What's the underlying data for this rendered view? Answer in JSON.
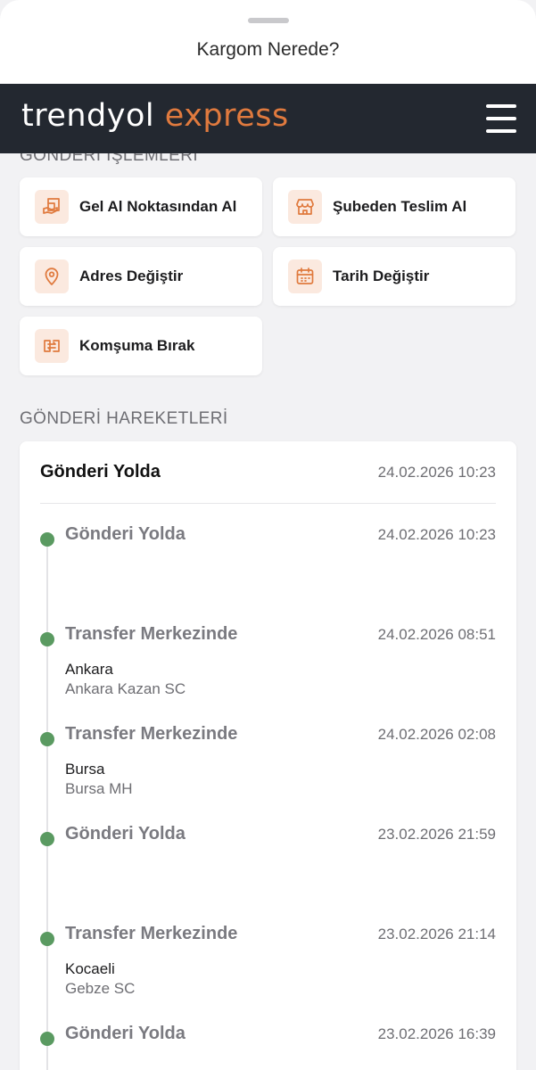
{
  "sheet": {
    "title": "Kargom Nerede?"
  },
  "header": {
    "logo_part1": "trendyol",
    "logo_part2": "express",
    "accent_color": "#e07a3e",
    "bar_color": "#232830"
  },
  "operations": {
    "title": "GÖNDERİ İŞLEMLERİ",
    "items": [
      {
        "label": "Gel Al Noktasından Al",
        "icon": "pickup-point-icon"
      },
      {
        "label": "Şubeden Teslim Al",
        "icon": "store-icon"
      },
      {
        "label": "Adres Değiştir",
        "icon": "location-pin-icon"
      },
      {
        "label": "Tarih Değiştir",
        "icon": "calendar-icon"
      },
      {
        "label": "Komşuma Bırak",
        "icon": "neighbor-transfer-icon"
      }
    ]
  },
  "movements": {
    "title": "GÖNDERİ HAREKETLERİ",
    "current_status": "Gönderi Yolda",
    "current_date": "24.02.2026 10:23",
    "status_dot_color": "#5a9a61",
    "events": [
      {
        "title": "Gönderi Yolda",
        "date": "24.02.2026 10:23",
        "city": "",
        "place": ""
      },
      {
        "title": "Transfer Merkezinde",
        "date": "24.02.2026 08:51",
        "city": "Ankara",
        "place": "Ankara Kazan SC"
      },
      {
        "title": "Transfer Merkezinde",
        "date": "24.02.2026 02:08",
        "city": "Bursa",
        "place": "Bursa MH"
      },
      {
        "title": "Gönderi Yolda",
        "date": "23.02.2026 21:59",
        "city": "",
        "place": ""
      },
      {
        "title": "Transfer Merkezinde",
        "date": "23.02.2026 21:14",
        "city": "Kocaeli",
        "place": "Gebze SC"
      },
      {
        "title": "Gönderi Yolda",
        "date": "23.02.2026 16:39",
        "city": "",
        "place": ""
      }
    ]
  }
}
